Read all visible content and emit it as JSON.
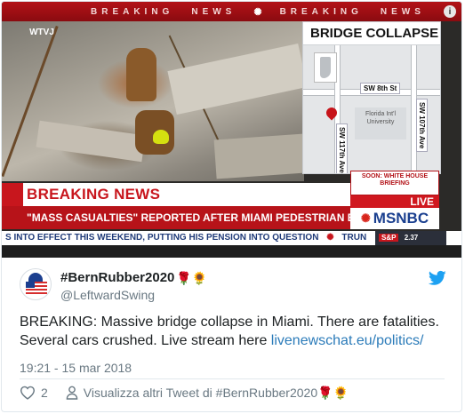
{
  "media": {
    "ticker_top": [
      "BREAKING",
      "NEWS",
      "BREAKING",
      "NEWS"
    ],
    "station_logo": "WTVJ",
    "station_sub": "",
    "map_title": "BRIDGE COLLAPSE",
    "map_labels": {
      "sw8": "SW 8th St",
      "sw107": "SW 107th Ave",
      "sw117": "SW 117th Ave",
      "campus": "Florida Int'l University"
    },
    "soon_box": "SOON: WHITE HOUSE BRIEFING",
    "live_tag": "LIVE",
    "breaking_news": "BREAKING NEWS",
    "headline": "\"MASS CASUALTIES\" REPORTED AFTER MIAMI PEDESTRIAN BRIDGE COLLAPSES",
    "network": "MSNBC",
    "crawl_text": "S INTO EFFECT THIS WEEKEND, PUTTING HIS PENSION INTO QUESTION",
    "crawl_tail": "TRUN",
    "sp_label": "S&P",
    "sp_value": "2.37",
    "colors": {
      "breaking_red": "#c8161d",
      "network_blue": "#1a3f8f"
    }
  },
  "tweet": {
    "display_name": "#BernRubber2020",
    "name_emojis": "🌹🌻",
    "handle": "@LeftwardSwing",
    "text_before_link": "BREAKING: Massive bridge collapse in Miami. There are fatalities. Several cars crushed. Live stream here ",
    "link_text": "livenewschat.eu/politics/",
    "timestamp": "19:21 - 15 mar 2018",
    "like_count": "2",
    "view_more": "Visualizza altri Tweet di #BernRubber2020🌹🌻",
    "colors": {
      "link": "#2b7bb9",
      "twitter_blue": "#1da1f2",
      "meta_gray": "#697882"
    }
  }
}
